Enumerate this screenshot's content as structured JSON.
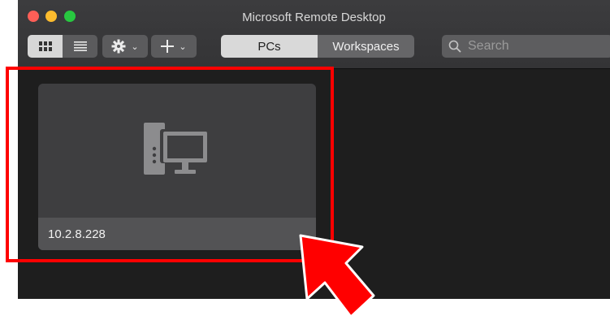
{
  "window": {
    "title": "Microsoft Remote Desktop"
  },
  "toolbar": {
    "view_modes": [
      "grid-icon",
      "list-icon"
    ],
    "settings_icon": "gear-icon",
    "add_icon": "plus-icon",
    "tabs": [
      {
        "label": "PCs",
        "active": true
      },
      {
        "label": "Workspaces",
        "active": false
      }
    ],
    "search": {
      "placeholder": "Search",
      "value": ""
    }
  },
  "pcs": [
    {
      "name": "10.2.8.228",
      "icon": "desktop-computer-icon"
    }
  ],
  "annotation": {
    "highlight_color": "#ff0000",
    "arrow_color": "#ff0000"
  }
}
